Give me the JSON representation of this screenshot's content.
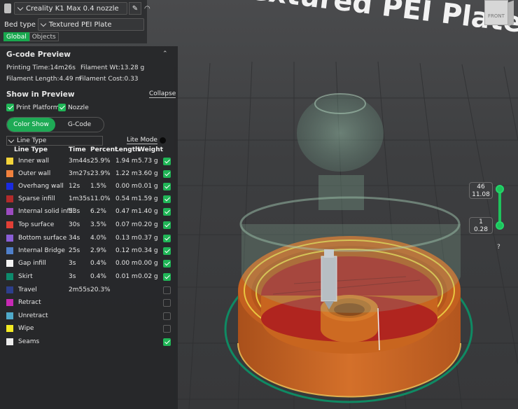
{
  "printer": {
    "name": "Creality K1 Max 0.4 nozzle"
  },
  "bed": {
    "label": "Bed type",
    "value": "Textured PEI Plate"
  },
  "tabs": [
    {
      "label": "Global",
      "active": true
    },
    {
      "label": "Objects",
      "active": false
    }
  ],
  "gcode_preview": {
    "title": "G-code Preview",
    "printing_time": "Printing Time:14m26s",
    "filament_wt": "Filament Wt:13.28 g",
    "filament_length": "Filament Length:4.49 m",
    "filament_cost": "Filament Cost:0.33"
  },
  "show_in_preview": {
    "title": "Show in Preview",
    "collapse": "Collapse",
    "print_platform": "Print Platform",
    "nozzle": "Nozzle"
  },
  "view_toggle": {
    "color_show": "Color Show",
    "gcode": "G-Code"
  },
  "line_type_select": "Line Type",
  "lite_mode": "Lite Mode",
  "table": {
    "headers": {
      "line_type": "Line Type",
      "time": "Time",
      "percent": "Percent",
      "length": "Length",
      "weight": "Weight"
    },
    "rows": [
      {
        "color": "#f3d33a",
        "name": "Inner wall",
        "time": "3m44s",
        "percent": "25.9%",
        "length": "1.94 m",
        "weight": "5.73 g",
        "checked": true
      },
      {
        "color": "#f0813d",
        "name": "Outer wall",
        "time": "3m27s",
        "percent": "23.9%",
        "length": "1.22 m",
        "weight": "3.60 g",
        "checked": true
      },
      {
        "color": "#1a2be0",
        "name": "Overhang wall",
        "time": "12s",
        "percent": "1.5%",
        "length": "0.00 m",
        "weight": "0.01 g",
        "checked": true
      },
      {
        "color": "#b22b2b",
        "name": "Sparse infill",
        "time": "1m35s",
        "percent": "11.0%",
        "length": "0.54 m",
        "weight": "1.59 g",
        "checked": true
      },
      {
        "color": "#9c4bc0",
        "name": "Internal solid infill",
        "time": "53s",
        "percent": "6.2%",
        "length": "0.47 m",
        "weight": "1.40 g",
        "checked": true
      },
      {
        "color": "#e23f36",
        "name": "Top surface",
        "time": "30s",
        "percent": "3.5%",
        "length": "0.07 m",
        "weight": "0.20 g",
        "checked": true
      },
      {
        "color": "#8a5ed6",
        "name": "Bottom surface",
        "time": "34s",
        "percent": "4.0%",
        "length": "0.13 m",
        "weight": "0.37 g",
        "checked": true
      },
      {
        "color": "#4f7fc9",
        "name": "Internal Bridge",
        "time": "25s",
        "percent": "2.9%",
        "length": "0.12 m",
        "weight": "0.34 g",
        "checked": true
      },
      {
        "color": "#f4f4f4",
        "name": "Gap infill",
        "time": "3s",
        "percent": "0.4%",
        "length": "0.00 m",
        "weight": "0.00 g",
        "checked": true
      },
      {
        "color": "#0d8a6c",
        "name": "Skirt",
        "time": "3s",
        "percent": "0.4%",
        "length": "0.01 m",
        "weight": "0.02 g",
        "checked": true
      },
      {
        "color": "#2d3f8c",
        "name": "Travel",
        "time": "2m55s",
        "percent": "20.3%",
        "length": "",
        "weight": "",
        "checked": false
      },
      {
        "color": "#c729b4",
        "name": "Retract",
        "time": "",
        "percent": "",
        "length": "",
        "weight": "",
        "checked": false
      },
      {
        "color": "#4fa9c9",
        "name": "Unretract",
        "time": "",
        "percent": "",
        "length": "",
        "weight": "",
        "checked": false
      },
      {
        "color": "#f2ea23",
        "name": "Wipe",
        "time": "",
        "percent": "",
        "length": "",
        "weight": "",
        "checked": false
      },
      {
        "color": "#ececec",
        "name": "Seams",
        "time": "",
        "percent": "",
        "length": "",
        "weight": "",
        "checked": true
      }
    ]
  },
  "plate_text": "Textured PEI Plate",
  "view_cube_label": "FRONT",
  "layer_slider": {
    "top_layer": "46",
    "top_height": "11.08",
    "bottom_layer": "1",
    "bottom_height": "0.28",
    "help": "?"
  },
  "colors": {
    "accent": "#1eaa55",
    "model_orange": "#c9621f",
    "infill_red": "#a8242a"
  }
}
